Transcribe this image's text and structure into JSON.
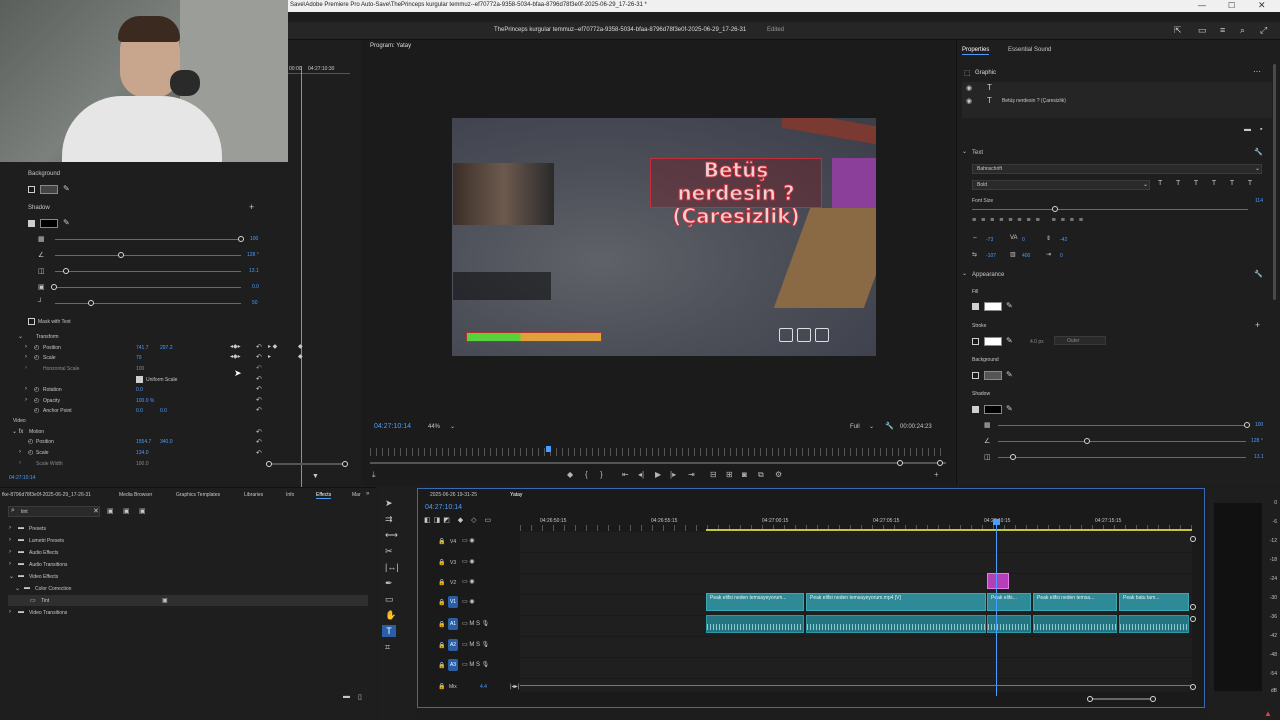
{
  "window": {
    "title": "Save\\Adobe Premiere Pro Auto-Save\\ThePrinceps kurgular temmuz--ef70772a-9358-5034-bfaa-8796d78f3e0f-2025-06-29_17-26-31 *",
    "subtitle": "ThePrinceps kurgular temmuz--ef70772a-9358-5034-bfaa-8796d78f3e0f-2025-06-29_17-26-31",
    "status": "Edited"
  },
  "source_monitor": {
    "timecode": "04:27:10:30",
    "start": "00:00"
  },
  "effect_controls": {
    "background_label": "Background",
    "shadow_label": "Shadow",
    "shadow_values": [
      "100",
      "128 °",
      "13.1",
      "0.0",
      "50"
    ],
    "mask_with_text": "Mask with Text",
    "transform_label": "Transform",
    "position_label": "Position",
    "position_x": "741.7",
    "position_y": "297.2",
    "scale_label": "Scale",
    "scale_value": "79",
    "h_scale_label": "Horizontal Scale",
    "h_scale_value": "100",
    "uniform_scale": "Uniform Scale",
    "rotation_label": "Rotation",
    "rotation_value": "0.0",
    "opacity_label": "Opacity",
    "opacity_value": "100.0 %",
    "anchor_label": "Anchor Point",
    "anchor_x": "0.0",
    "anchor_y": "0.0",
    "video_label": "Video",
    "motion_label": "Motion",
    "motion_position_label": "Position",
    "motion_pos_x": "1554.7",
    "motion_pos_y": "340.0",
    "motion_scale_label": "Scale",
    "motion_scale_value": "134.0",
    "scale_width_label": "Scale Width",
    "scale_width_value": "100.0",
    "bottom_timecode": "04:27:10:14"
  },
  "program_monitor": {
    "title": "Program: Yatay",
    "timecode": "04:27:10:14",
    "zoom": "44%",
    "quality": "Full",
    "duration": "00:00:24:23",
    "overlay_text_line1": "Betüş nerdesin ?",
    "overlay_text_line2": "(Çaresizlik)"
  },
  "properties": {
    "tab_properties": "Properties",
    "tab_essential_sound": "Essential Sound",
    "graphic_label": "Graphic",
    "layer_text": "Betüş nerdesin ? (Çaresizlik)",
    "text_section": "Text",
    "font": "Bahnschrift",
    "weight": "Bold",
    "font_size_label": "Font Size",
    "font_size_value": "114",
    "metrics": [
      "-73",
      "0",
      "-42",
      "-107",
      "400",
      "0"
    ],
    "appearance_label": "Appearance",
    "fill_label": "Fill",
    "stroke_label": "Stroke",
    "stroke_px": "4.0 px",
    "stroke_type": "Outer",
    "background_label": "Background",
    "shadow_label": "Shadow",
    "shadow_values": [
      "100",
      "128 °",
      "13.1"
    ]
  },
  "project_panel": {
    "tabs": [
      "fke-8796d78f3e0f-2025-06-29_17-26-31",
      "Media Browser",
      "Graphics Templates",
      "Libraries",
      "Info",
      "Effects",
      "Mar"
    ],
    "search_value": "tint",
    "tree": [
      "Presets",
      "Lumetri Presets",
      "Audio Effects",
      "Audio Transitions",
      "Video Effects",
      "Color Correction",
      "Tint",
      "Video Transitions"
    ]
  },
  "timeline": {
    "tabs": [
      "2025-06-26 19-31-25",
      "Yatay"
    ],
    "timecode": "04:27:10:14",
    "ruler": [
      "04:26:50:15",
      "04:26:55:15",
      "04:27:00:15",
      "04:27:05:15",
      "04:27:10:15",
      "04:27:15:15"
    ],
    "tracks": [
      "V4",
      "V3",
      "V2",
      "V1",
      "A1",
      "A2",
      "A3"
    ],
    "mix_label": "Mix",
    "mix_value": "4.4",
    "clips": [
      "Peak elifsi neden temsayeyorum...",
      "Peak elifsi neden temsayeyorum.mp4 [V]",
      "Peak elifs...",
      "Peak elifsi neden temsa...",
      "Peak batu tam..."
    ]
  },
  "meter": {
    "labels": [
      "0",
      "-6",
      "-12",
      "-18",
      "-24",
      "-30",
      "-36",
      "-42",
      "-48",
      "-54",
      "dB"
    ]
  }
}
